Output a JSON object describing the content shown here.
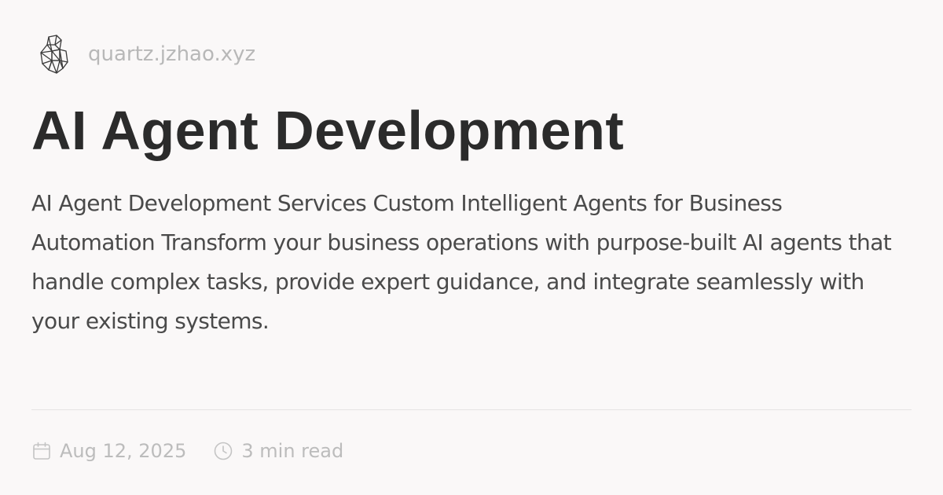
{
  "site": {
    "name": "quartz.jzhao.xyz",
    "logo_icon": "crystal-icon"
  },
  "page": {
    "title": "AI Agent Development",
    "description": "AI Agent Development Services Custom Intelligent Agents for Business Automation Transform your business operations with purpose-built AI agents that handle complex tasks, provide expert guidance, and integrate seamlessly with your existing systems."
  },
  "meta": {
    "date": "Aug 12, 2025",
    "date_icon": "calendar-icon",
    "read_time": "3 min read",
    "read_time_icon": "clock-icon"
  },
  "colors": {
    "background": "#faf8f8",
    "title": "#2b2b2b",
    "description": "#4a4a4a",
    "muted": "#bcbcbc",
    "divider": "#e6e4e4"
  }
}
